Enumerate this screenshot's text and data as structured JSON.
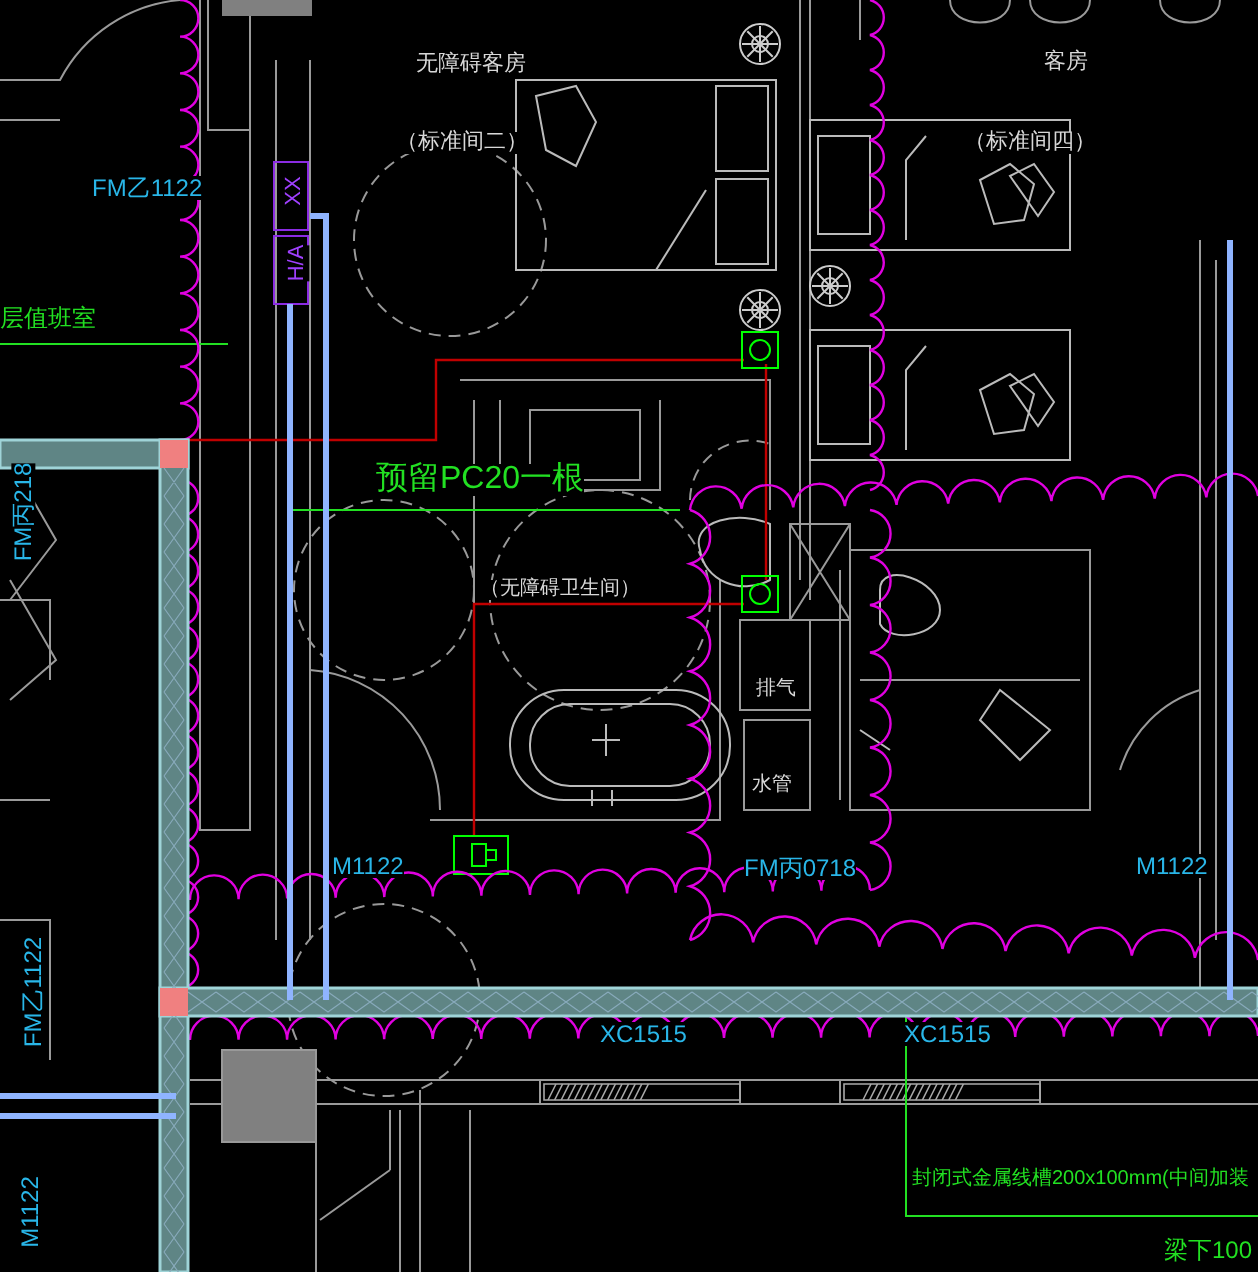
{
  "drawing": {
    "labels": [
      {
        "text": "无障碍客房",
        "kind": "room"
      },
      {
        "text": "（标准间二）",
        "kind": "room"
      },
      {
        "text": "客房",
        "kind": "room"
      },
      {
        "text": "（标准间四）",
        "kind": "room"
      },
      {
        "text": "FM乙1122",
        "kind": "door"
      },
      {
        "text": "层值班室",
        "kind": "note"
      },
      {
        "text": "预留PC20一根",
        "kind": "note"
      },
      {
        "text": "（无障碍卫生间）",
        "kind": "room"
      },
      {
        "text": "排气",
        "kind": "room"
      },
      {
        "text": "水管",
        "kind": "room"
      },
      {
        "text": "M1122",
        "kind": "door"
      },
      {
        "text": "FM丙0718",
        "kind": "door"
      },
      {
        "text": "M1122",
        "kind": "door"
      },
      {
        "text": "XC1515",
        "kind": "door"
      },
      {
        "text": "XC1515",
        "kind": "door"
      },
      {
        "text": "封闭式金属线槽200x100mm(中间加装",
        "kind": "note"
      },
      {
        "text": "梁下100",
        "kind": "note"
      },
      {
        "text": "FM丙218",
        "kind": "door"
      },
      {
        "text": "FM乙1122",
        "kind": "door"
      },
      {
        "text": "M1122",
        "kind": "door"
      },
      {
        "text": "XX",
        "kind": "tag"
      },
      {
        "text": "H/A",
        "kind": "tag"
      }
    ]
  }
}
